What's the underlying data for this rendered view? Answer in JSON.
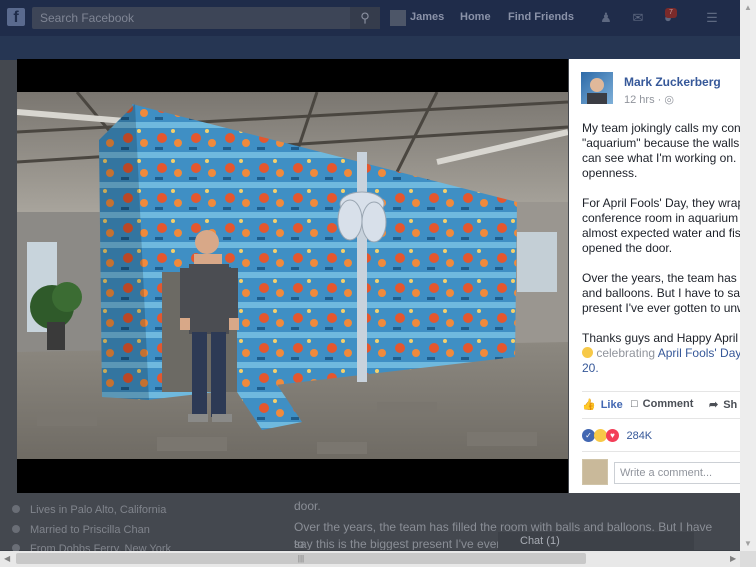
{
  "topbar": {
    "search_placeholder": "Search Facebook",
    "user_name": "James",
    "nav_home": "Home",
    "nav_find_friends": "Find Friends",
    "notification_count": "7"
  },
  "background_page": {
    "intro_items": [
      {
        "icon": "home-icon",
        "prefix": "Lives in ",
        "link": "Palo Alto, California"
      },
      {
        "icon": "heart-icon",
        "prefix": "Married to ",
        "link": "Priscilla Chan"
      },
      {
        "icon": "location-icon",
        "prefix": "",
        "link": "From Dobbs Ferry, New York"
      }
    ],
    "post_text_line1": "door.",
    "post_text_line2": "Over the years, the team has filled the room with balls and balloons. But I have to",
    "post_text_line3": "say this is the biggest present I've ever g",
    "chat_label": "Chat (1)"
  },
  "post": {
    "author": "Mark Zuckerberg",
    "time": "12 hrs",
    "paragraphs": [
      [
        "My team jokingly calls my confe",
        "\"aquarium\" because the walls a",
        "can see what I'm working on. It f",
        "openness."
      ],
      [
        "For April Fools' Day, they wrapp",
        "conference room in aquarium g",
        "almost expected water and fish",
        "opened the door."
      ],
      [
        "Over the years, the team has fill",
        "and balloons. But I have to say t",
        "present I've ever gotten to unwra"
      ],
      [
        "Thanks guys and Happy April F"
      ]
    ],
    "celebrating_prefix": "celebrating",
    "celebrating_event": "April Fools' Day",
    "celebrating_event_cont": "20.",
    "actions": {
      "like": "Like",
      "comment": "Comment",
      "share": "Sh"
    },
    "reaction_count": "284K",
    "comment_placeholder": "Write a comment..."
  },
  "colors": {
    "link": "#365899",
    "like_blue": "#4267b2",
    "topbar": "#1f2c4a",
    "viewer_bg": "#000000"
  }
}
